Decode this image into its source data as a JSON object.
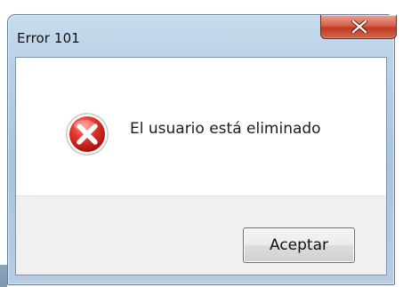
{
  "window": {
    "title": "Error 101",
    "close_icon": "close-icon"
  },
  "dialog": {
    "icon": "error-icon",
    "message": "El usuario está eliminado",
    "ok_label": "Aceptar"
  },
  "colors": {
    "frame": "#b9d1e8",
    "close_button": "#c0391f",
    "error_red": "#d6231b",
    "button_bar": "#f0f0f0"
  }
}
